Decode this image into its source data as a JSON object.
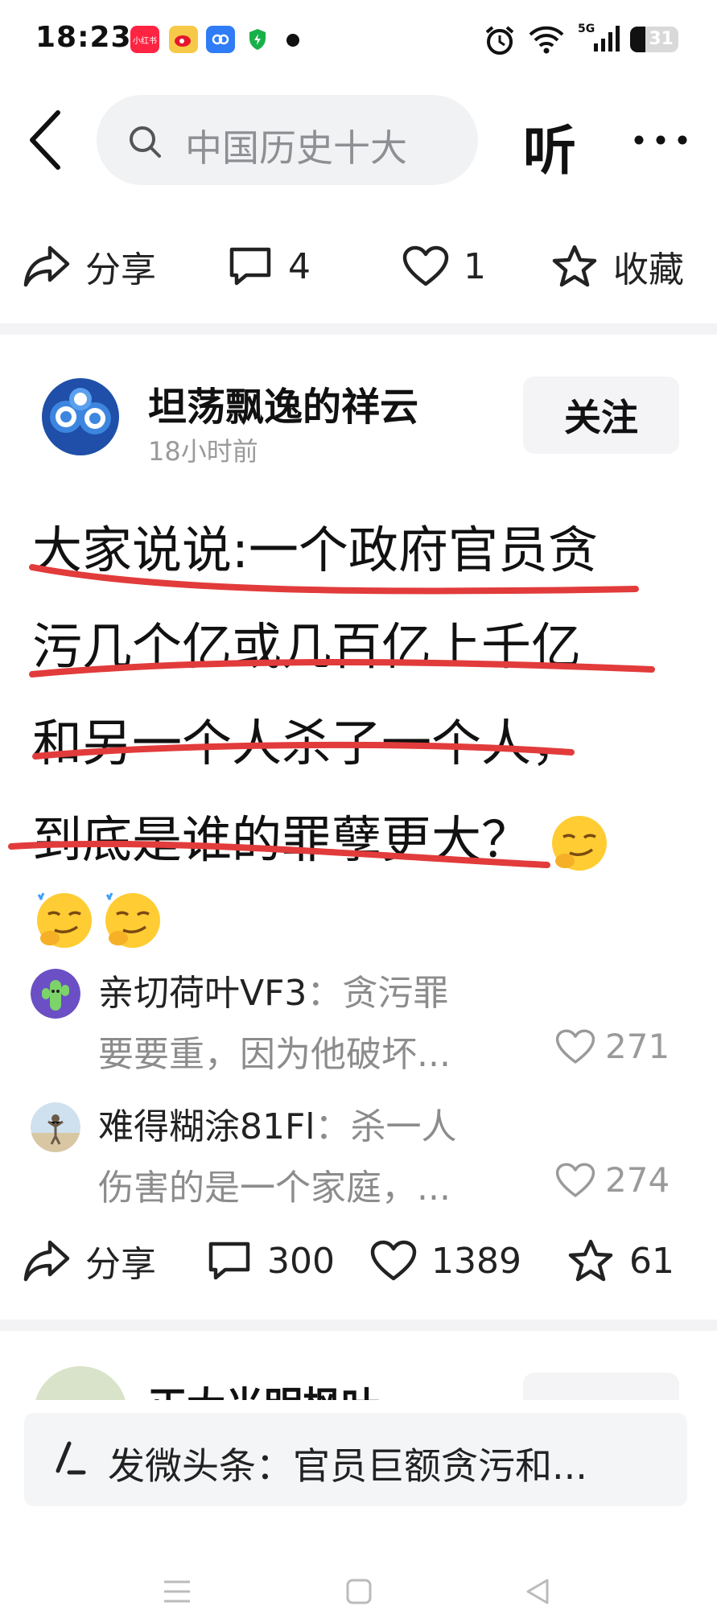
{
  "status_bar": {
    "time": "18:23",
    "app_icons": [
      {
        "name": "xiaohongshu-icon",
        "label": "小红书",
        "color": "#ff2442"
      },
      {
        "name": "weibo-icon",
        "label": "微博",
        "color": "#f5a623"
      },
      {
        "name": "app-icon",
        "label": "",
        "color": "#2f7cf6"
      },
      {
        "name": "shield-icon",
        "label": "",
        "color": "#18b04a"
      }
    ],
    "network": "5G",
    "battery": "31"
  },
  "top_bar": {
    "search_placeholder": "中国历史十大",
    "listen_label": "听"
  },
  "prev_post_actions": {
    "share_label": "分享",
    "comments": "4",
    "likes": "1",
    "favorite_label": "收藏"
  },
  "post": {
    "author": "坦荡飘逸的祥云",
    "time": "18小时前",
    "follow_label": "关注",
    "lines": [
      "大家说说:一个政府官员贪",
      "污几个亿或几百亿上千亿",
      "和另一个人杀了一个人，",
      "到底是谁的罪孽更大？"
    ],
    "underline_color": "#e23b3b"
  },
  "comments": [
    {
      "user": "亲切荷叶VF3",
      "sep": "：",
      "text": "贪污罪",
      "text2": "要要重，因为他破坏...",
      "likes": "271"
    },
    {
      "user": "难得糊涂81Fl",
      "sep": "：",
      "text": "杀一人",
      "text2": "伤害的是一个家庭，...",
      "likes": "274"
    }
  ],
  "post_actions": {
    "share_label": "分享",
    "comments": "300",
    "likes": "1389",
    "favorites": "61"
  },
  "next_post": {
    "author": "正大光明枫叶"
  },
  "banner": {
    "text": "发微头条：官员巨额贪污和..."
  }
}
